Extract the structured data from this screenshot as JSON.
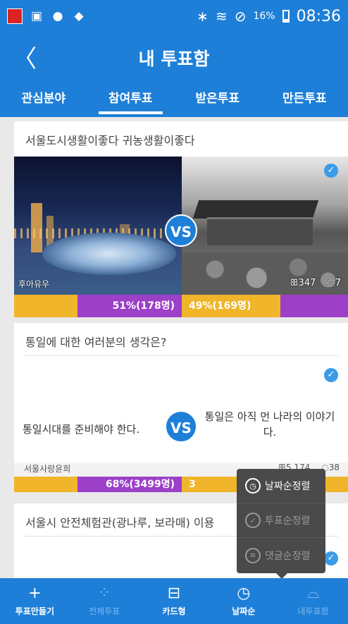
{
  "statusbar": {
    "app_icon": "app-notification-icon",
    "battery": "16%",
    "time": "08:36"
  },
  "header": {
    "back_icon": "chevron-left-icon",
    "back_glyph": "〈",
    "title": "내 투표함"
  },
  "tabs": [
    {
      "label": "관심분야"
    },
    {
      "label": "참여투표",
      "active": true
    },
    {
      "label": "받은투표"
    },
    {
      "label": "만든투표"
    }
  ],
  "cards": [
    {
      "question": "서울도시생활이좋다 귀농생활이좋다",
      "vs": "VS",
      "author": "후아유우",
      "participants": "347",
      "comments": "7",
      "left_result": "51%(178명)",
      "right_result": "49%(169명)",
      "left_percent": 51,
      "right_percent": 49
    },
    {
      "question": "통일에 대한 여러분의 생각은?",
      "left_option": "통일시대를 준비해야 한다.",
      "right_option": "통일은 아직 먼 나라의 이야기다.",
      "vs": "VS",
      "author": "서울사랑윤희",
      "participants": "5,174",
      "comments": "38",
      "left_result": "68%(3499명)",
      "right_result": "3",
      "left_percent": 68,
      "right_percent": 32
    },
    {
      "question": "서울시 안전체험관(광나루, 보라매) 이용"
    }
  ],
  "sort_popup": {
    "items": [
      {
        "label": "날짜순정렬",
        "icon": "clock-icon",
        "active": true
      },
      {
        "label": "투표순정렬",
        "icon": "check-circle-icon",
        "active": false
      },
      {
        "label": "댓글순정렬",
        "icon": "comment-list-icon",
        "active": false
      }
    ]
  },
  "bottom_nav": [
    {
      "label": "투표만들기",
      "icon": "plus-icon"
    },
    {
      "label": "전체투표",
      "icon": "all-votes-icon",
      "dim": true
    },
    {
      "label": "카드형",
      "icon": "card-view-icon"
    },
    {
      "label": "날짜순",
      "icon": "clock-icon"
    },
    {
      "label": "내투표함",
      "icon": "my-votes-icon",
      "dim": true
    }
  ],
  "colors": {
    "primary": "#1e7fd8",
    "left_bar": "#9c40c8",
    "right_bar": "#f0b52b",
    "check": "#3a9be8"
  }
}
